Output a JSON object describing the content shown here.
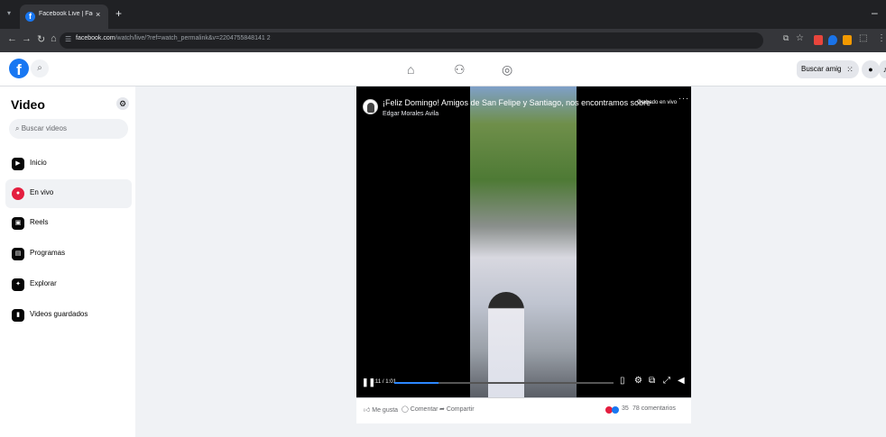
{
  "browser": {
    "tab_menu_icon": "chevron-down-icon",
    "tab_title": "Facebook Live | Facebook",
    "tab_close": "×",
    "new_tab": "+",
    "minimize": "–",
    "url_host": "facebook.com",
    "url_path": "/watch/live/?ref=watch_permalink&v=2204755848141 2"
  },
  "header": {
    "search_icon": "search-icon",
    "buscar_amigos": "Buscar amigos"
  },
  "sidebar": {
    "title": "Video",
    "search_placeholder": "Buscar videos",
    "items": [
      {
        "label": "Inicio",
        "icon": "home-icon"
      },
      {
        "label": "En vivo",
        "icon": "live-icon"
      },
      {
        "label": "Reels",
        "icon": "reels-icon"
      },
      {
        "label": "Programas",
        "icon": "programs-icon"
      },
      {
        "label": "Explorar",
        "icon": "explore-icon"
      },
      {
        "label": "Videos guardados",
        "icon": "saved-icon"
      }
    ]
  },
  "post": {
    "title": "¡Feliz Domingo! Amigos de San Felipe y Santiago, nos encontramos sobre la P...",
    "author": "Edgar Morales Avila",
    "live_label": "Grabado en vivo",
    "more": "···",
    "time": "0:11 / 1:01",
    "progress": 0.2,
    "actions": {
      "like": "Me gusta",
      "comment": "Comentar",
      "share": "Compartir"
    },
    "reaction_count": "35",
    "comments_count": "78 comentarios",
    "colors": {
      "accent": "#2d88ff",
      "brand": "#1877f2",
      "live": "#e41e3f"
    }
  }
}
